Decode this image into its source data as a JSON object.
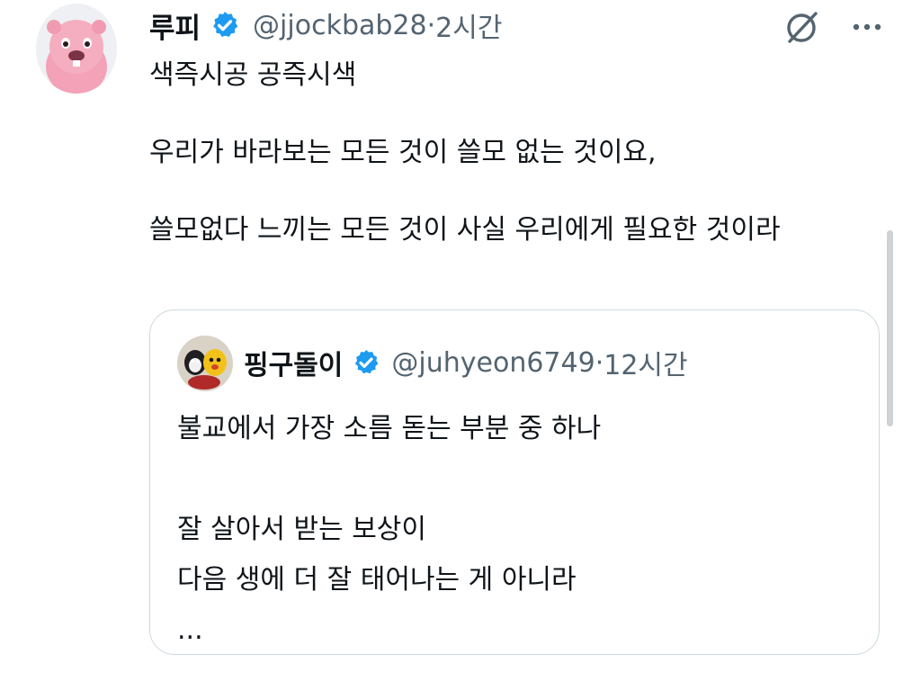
{
  "post": {
    "display_name": "루피",
    "handle": "@jjockbab28",
    "separator": "·",
    "time": "2시간",
    "lines": [
      "색즉시공 공즉시색",
      "우리가 바라보는 모든 것이 쓸모 없는 것이요,",
      "쓸모없다 느끼는 모든 것이 사실 우리에게 필요한 것이라"
    ]
  },
  "icons": {
    "avatar": "pink-beaver-character",
    "verified": "verified-badge",
    "grok": "grok-icon",
    "more": "more-icon"
  },
  "quote": {
    "display_name": "핑구돌이",
    "handle": "@juhyeon6749",
    "separator": "·",
    "time": "12시간",
    "line1": "불교에서 가장 소름 돋는 부분 중 하나",
    "line2": "잘 살아서 받는 보상이",
    "line3": "다음 생에 더 잘 태어나는 게 아니라",
    "ellipsis": "..."
  },
  "colors": {
    "text": "#0f1419",
    "secondary": "#536471",
    "verified_blue": "#1d9bf0",
    "border": "#cfd9de",
    "avatar_pink": "#f5a9bd"
  }
}
